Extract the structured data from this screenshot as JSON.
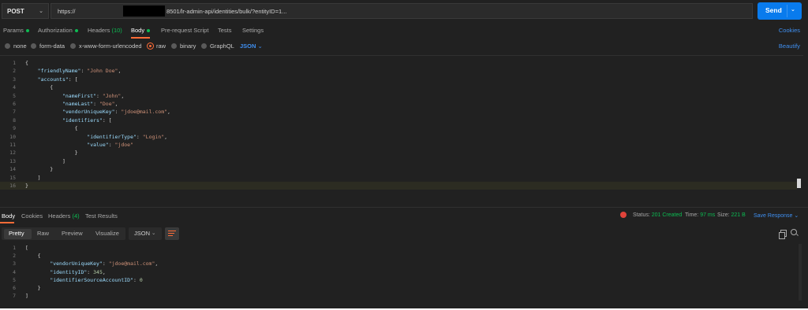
{
  "request": {
    "method": "POST",
    "url_prefix": "https://",
    "url_suffix": "8501/lr-admin-api/identities/bulk/?entityID=1...",
    "send_label": "Send"
  },
  "tabs": [
    {
      "label": "Params",
      "dot": true
    },
    {
      "label": "Authorization",
      "dot": true
    },
    {
      "label": "Headers",
      "count": "(10)"
    },
    {
      "label": "Body",
      "dot": true,
      "active": true
    },
    {
      "label": "Pre-request Script"
    },
    {
      "label": "Tests"
    },
    {
      "label": "Settings"
    }
  ],
  "cookies_label": "Cookies",
  "body_types": [
    {
      "label": "none",
      "selected": false
    },
    {
      "label": "form-data",
      "selected": false
    },
    {
      "label": "x-www-form-urlencoded",
      "selected": false
    },
    {
      "label": "raw",
      "selected": true
    },
    {
      "label": "binary",
      "selected": false
    },
    {
      "label": "GraphQL",
      "selected": false
    }
  ],
  "body_format": "JSON",
  "beautify_label": "Beautify",
  "request_body_lines": [
    "{",
    "    \"friendlyName\": \"John Doe\",",
    "    \"accounts\": [",
    "        {",
    "            \"nameFirst\": \"John\",",
    "            \"nameLast\": \"Doe\",",
    "            \"vendorUniqueKey\": \"jdoe@mail.com\",",
    "            \"identifiers\": [",
    "                {",
    "                    \"identifierType\": \"Login\",",
    "                    \"value\": \"jdoe\"",
    "                }",
    "            ]",
    "        }",
    "    ]",
    "}"
  ],
  "response": {
    "tabs": [
      {
        "label": "Body",
        "active": true
      },
      {
        "label": "Cookies"
      },
      {
        "label": "Headers",
        "count": "(4)"
      },
      {
        "label": "Test Results"
      }
    ],
    "status_label": "Status:",
    "status_value": "201 Created",
    "time_label": "Time:",
    "time_value": "97 ms",
    "size_label": "Size:",
    "size_value": "221 B",
    "save_label": "Save Response",
    "view_modes": [
      "Pretty",
      "Raw",
      "Preview",
      "Visualize"
    ],
    "format": "JSON",
    "body_lines": [
      "[",
      "    {",
      "        \"vendorUniqueKey\": \"jdoe@mail.com\",",
      "        \"identityID\": 345,",
      "        \"identifierSourceAccountID\": 0",
      "    }",
      "]"
    ]
  },
  "colors": {
    "accent": "#ff6c37",
    "send": "#097bed",
    "success": "#0cbb52",
    "link": "#3f8ff0"
  }
}
